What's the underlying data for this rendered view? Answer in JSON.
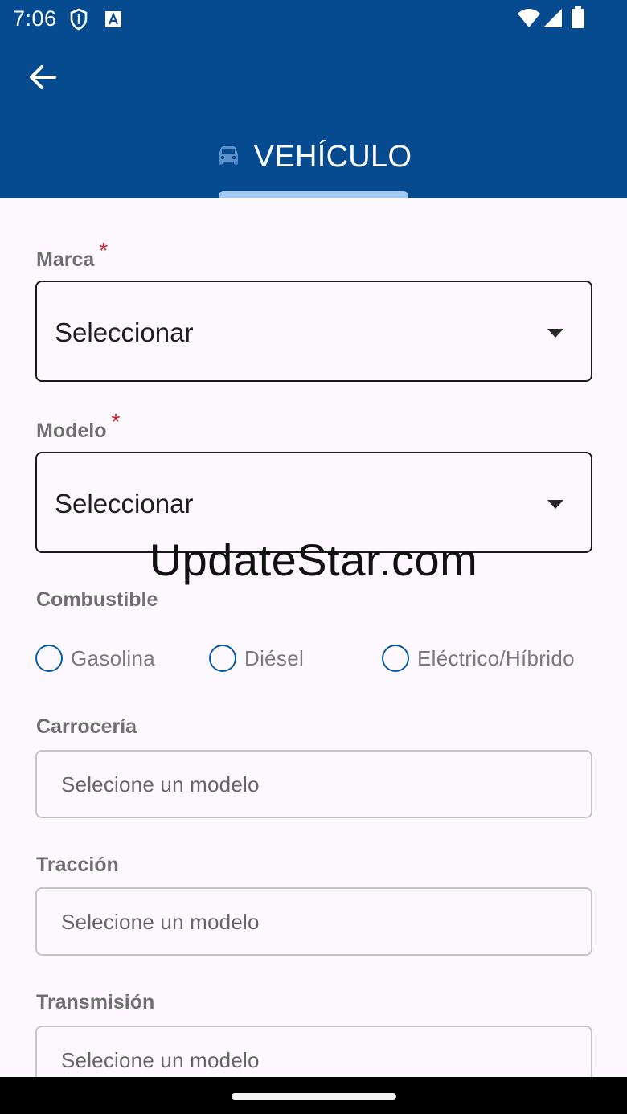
{
  "status_bar": {
    "time": "7:06"
  },
  "header": {
    "back_icon": "arrow-left-icon",
    "tab_icon": "car-icon",
    "tab_label": "VEHÍCULO",
    "accent_color": "#064a8f",
    "indicator_color": "#9fc9f3"
  },
  "form": {
    "marca": {
      "label": "Marca",
      "required_mark": "*",
      "value": "Seleccionar"
    },
    "modelo": {
      "label": "Modelo",
      "required_mark": "*",
      "value": "Seleccionar"
    },
    "combustible": {
      "label": "Combustible",
      "options": [
        "Gasolina",
        "Diésel",
        "Eléctrico/Híbrido"
      ]
    },
    "carroceria": {
      "label": "Carrocería",
      "value": "Selecione un modelo"
    },
    "traccion": {
      "label": "Tracción",
      "value": "Selecione un modelo"
    },
    "transmision": {
      "label": "Transmisión",
      "value": "Selecione un modelo"
    }
  },
  "watermark": "UpdateStar.com"
}
